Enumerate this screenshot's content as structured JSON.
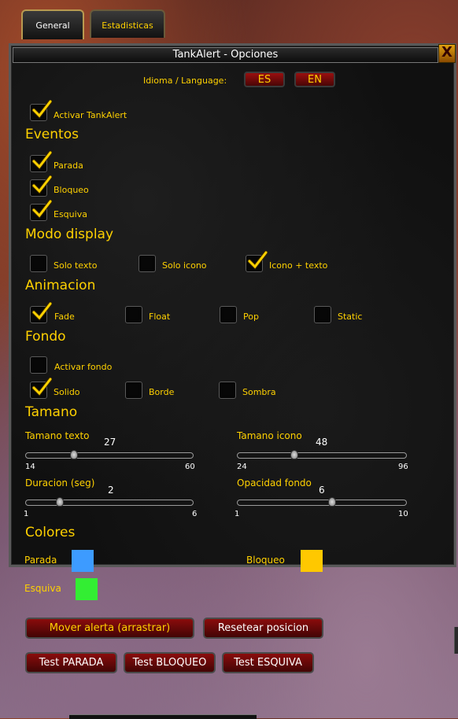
{
  "tabs": [
    {
      "label": "General",
      "active": true
    },
    {
      "label": "Estadisticas",
      "active": false
    }
  ],
  "window": {
    "title": "TankAlert - Opciones",
    "close_glyph": "X"
  },
  "language": {
    "label": "Idioma / Language:",
    "es": "ES",
    "en": "EN"
  },
  "activate": {
    "label": "Activar TankAlert",
    "checked": true
  },
  "sections": {
    "eventos": "Eventos",
    "modo": "Modo display",
    "animacion": "Animacion",
    "fondo": "Fondo",
    "tamano": "Tamano",
    "colores": "Colores"
  },
  "eventos": [
    {
      "label": "Parada",
      "checked": true
    },
    {
      "label": "Bloqueo",
      "checked": true
    },
    {
      "label": "Esquiva",
      "checked": true
    }
  ],
  "modo": [
    {
      "label": "Solo texto",
      "checked": false
    },
    {
      "label": "Solo icono",
      "checked": false
    },
    {
      "label": "Icono + texto",
      "checked": true
    }
  ],
  "animacion": [
    {
      "label": "Fade",
      "checked": true
    },
    {
      "label": "Float",
      "checked": false
    },
    {
      "label": "Pop",
      "checked": false
    },
    {
      "label": "Static",
      "checked": false
    }
  ],
  "fondo": {
    "activar": {
      "label": "Activar fondo",
      "checked": false
    },
    "styles": [
      {
        "label": "Solido",
        "checked": true
      },
      {
        "label": "Borde",
        "checked": false
      },
      {
        "label": "Sombra",
        "checked": false
      }
    ]
  },
  "sliders": {
    "tam_texto": {
      "label": "Tamano texto",
      "value": 27,
      "min": 14,
      "max": 60,
      "value_text": "27",
      "min_text": "14",
      "max_text": "60"
    },
    "tam_icono": {
      "label": "Tamano icono",
      "value": 48,
      "min": 24,
      "max": 96,
      "value_text": "48",
      "min_text": "24",
      "max_text": "96"
    },
    "duracion": {
      "label": "Duracion (seg)",
      "value": 2,
      "min": 1,
      "max": 6,
      "value_text": "2",
      "min_text": "1",
      "max_text": "6"
    },
    "opacidad": {
      "label": "Opacidad fondo",
      "value": 6,
      "min": 1,
      "max": 10,
      "value_text": "6",
      "min_text": "1",
      "max_text": "10"
    }
  },
  "colors": {
    "parada": {
      "label": "Parada",
      "color": "#3d9bff"
    },
    "bloqueo": {
      "label": "Bloqueo",
      "color": "#ffc800"
    },
    "esquiva": {
      "label": "Esquiva",
      "color": "#33ee33"
    }
  },
  "buttons": {
    "mover": "Mover alerta (arrastrar)",
    "resetear": "Resetear posicion",
    "test_parada": "Test PARADA",
    "test_bloqueo": "Test BLOQUEO",
    "test_esquiva": "Test ESQUIVA"
  }
}
